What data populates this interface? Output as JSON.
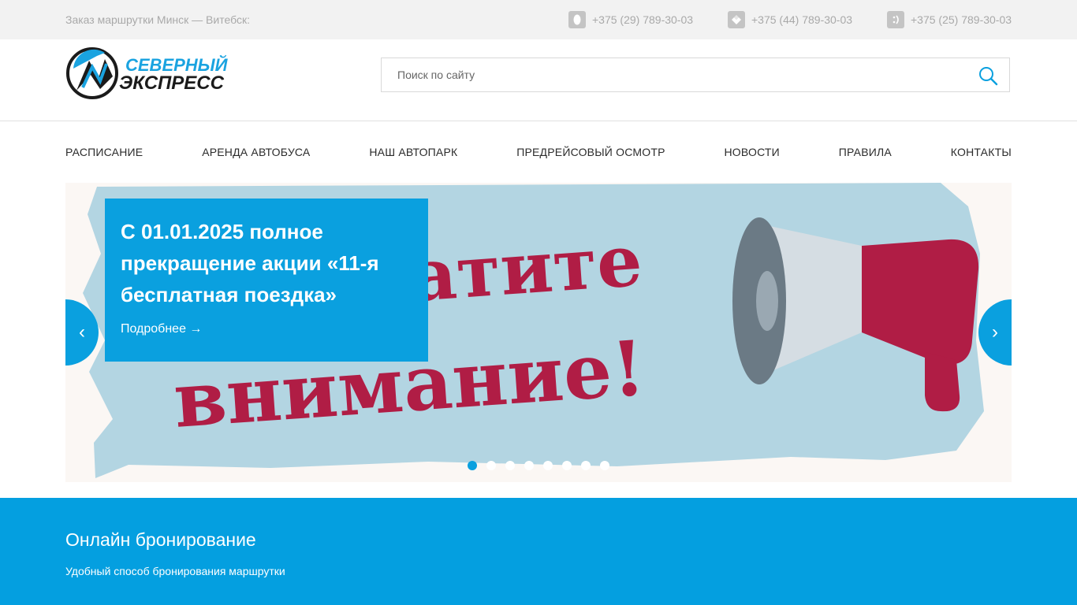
{
  "topbar": {
    "tagline": "Заказ маршрутки Минск — Витебск:",
    "phones": [
      {
        "icon": "a1-icon",
        "number": "+375 (29) 789-30-03"
      },
      {
        "icon": "life-icon",
        "number": "+375 (44) 789-30-03"
      },
      {
        "icon": "mts-icon",
        "number": "+375 (25) 789-30-03"
      }
    ]
  },
  "logo": {
    "line1": "СЕВЕРНЫЙ",
    "line2": "ЭКСПРЕСС"
  },
  "search": {
    "placeholder": "Поиск по сайту"
  },
  "nav": [
    "РАСПИСАНИЕ",
    "АРЕНДА АВТОБУСА",
    "НАШ АВТОПАРК",
    "ПРЕДРЕЙСОВЫЙ ОСМОТР",
    "НОВОСТИ",
    "ПРАВИЛА",
    "КОНТАКТЫ"
  ],
  "slider": {
    "title": "С 01.01.2025 полное прекращение акции «11-я бесплатная поездка»",
    "more": "Подробнее →",
    "image_text_1": "атите",
    "image_text_2": "внимание!",
    "prev": "‹",
    "next": "›",
    "dots_count": 8,
    "active_dot": 1
  },
  "booking": {
    "title": "Онлайн бронирование",
    "subtitle": "Удобный способ бронирования маршрутки"
  },
  "colors": {
    "accent": "#0aa0df",
    "megaphone": "#b01d45",
    "brush": "#b3d5e2"
  }
}
